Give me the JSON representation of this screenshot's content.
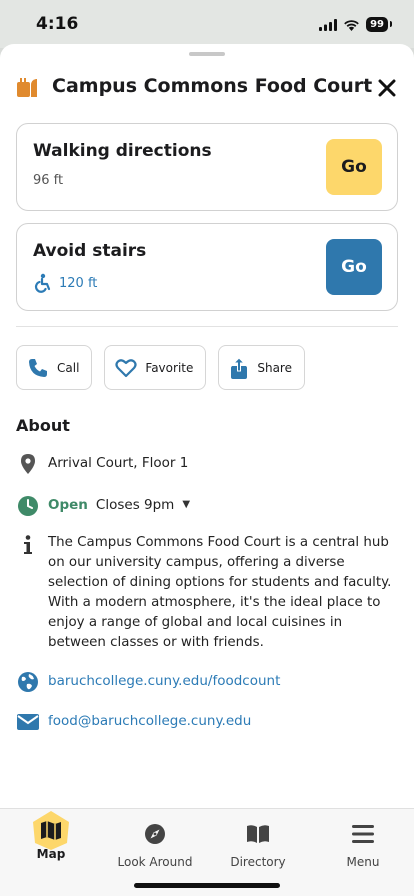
{
  "status_bar": {
    "time": "4:16",
    "battery": "99"
  },
  "header": {
    "title": "Campus Commons Food Court"
  },
  "directions": [
    {
      "title": "Walking directions",
      "distance": "96 ft",
      "go_label": "Go"
    },
    {
      "title": "Avoid stairs",
      "distance": "120 ft",
      "go_label": "Go"
    }
  ],
  "actions": {
    "call": "Call",
    "favorite": "Favorite",
    "share": "Share"
  },
  "about": {
    "heading": "About",
    "location": "Arrival Court, Floor 1",
    "status": "Open",
    "hours": "Closes 9pm",
    "description": "The Campus Commons Food Court is a central hub on our university campus, offering a diverse selection of dining options for students and faculty. With a modern atmosphere, it's the ideal place to enjoy a range of global and local cuisines in between classes or with friends.",
    "website": "baruchcollege.cuny.edu/foodcount",
    "email": "food@baruchcollege.cuny.edu"
  },
  "tabs": [
    "Map",
    "Look Around",
    "Directory",
    "Menu"
  ],
  "colors": {
    "accent_blue": "#2f78ad",
    "accent_yellow": "#fdd76b",
    "open_green": "#3f8a68",
    "link_blue": "#2c7bb6"
  }
}
